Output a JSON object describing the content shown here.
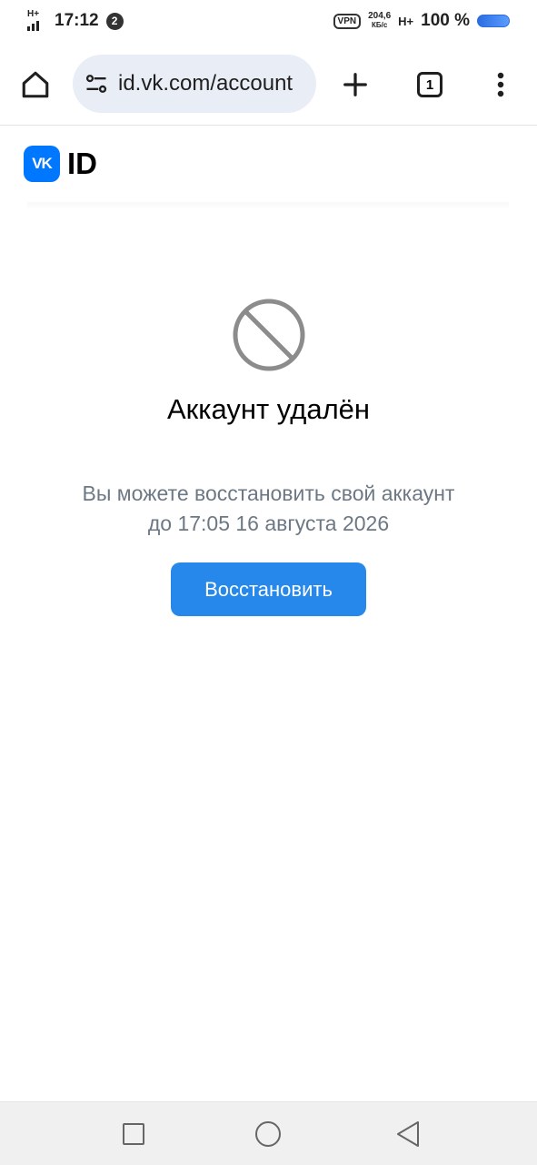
{
  "status_bar": {
    "network_type_left": "H+",
    "time": "17:12",
    "notification_count": "2",
    "vpn_label": "VPN",
    "speed_value": "204,6",
    "speed_unit": "КБ/с",
    "network_type_right": "H+",
    "battery_percent": "100 %"
  },
  "browser": {
    "url": "id.vk.com/account",
    "tab_count": "1"
  },
  "header": {
    "logo_text": "VK",
    "id_label": "ID"
  },
  "main": {
    "title": "Аккаунт удалён",
    "description_line1": "Вы можете восстановить свой аккаунт",
    "description_line2": "до 17:05 16 августа 2026",
    "restore_button": "Восстановить"
  },
  "colors": {
    "accent": "#2688eb",
    "vk_blue": "#0077ff",
    "muted_text": "#6d7885",
    "icon_gray": "#8c8c8c"
  }
}
